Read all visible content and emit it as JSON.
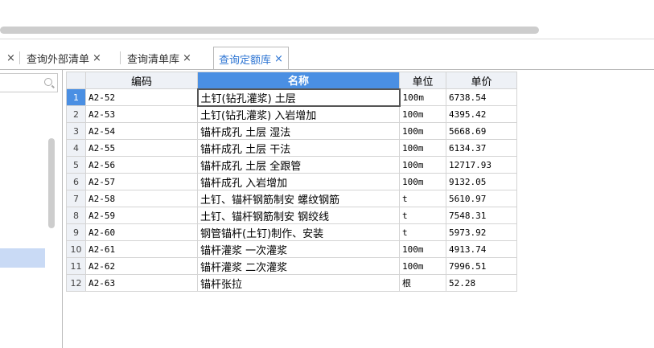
{
  "tabs": [
    {
      "label": "查询外部清单",
      "close": "×"
    },
    {
      "label": "查询清单库",
      "close": "×"
    },
    {
      "label": "查询定额库",
      "close": "×",
      "active": true
    }
  ],
  "leading_tab_close": "×",
  "colors": {
    "accent": "#4a8fe3",
    "active_tab_text": "#2c74d3",
    "selected_row": "#c9daf5"
  },
  "table": {
    "columns": [
      "编码",
      "名称",
      "单位",
      "单价"
    ],
    "rows": [
      {
        "no": "1",
        "code": "A2-52",
        "name": "土钉(钻孔灌浆) 土层",
        "unit": "100m",
        "price": "6738.54"
      },
      {
        "no": "2",
        "code": "A2-53",
        "name": "土钉(钻孔灌浆) 入岩增加",
        "unit": "100m",
        "price": "4395.42"
      },
      {
        "no": "3",
        "code": "A2-54",
        "name": "锚杆成孔 土层 湿法",
        "unit": "100m",
        "price": "5668.69"
      },
      {
        "no": "4",
        "code": "A2-55",
        "name": "锚杆成孔 土层 干法",
        "unit": "100m",
        "price": "6134.37"
      },
      {
        "no": "5",
        "code": "A2-56",
        "name": "锚杆成孔 土层 全跟管",
        "unit": "100m",
        "price": "12717.93"
      },
      {
        "no": "6",
        "code": "A2-57",
        "name": "锚杆成孔 入岩增加",
        "unit": "100m",
        "price": "9132.05"
      },
      {
        "no": "7",
        "code": "A2-58",
        "name": "土钉、锚杆钢筋制安 螺纹钢筋",
        "unit": "t",
        "price": "5610.97"
      },
      {
        "no": "8",
        "code": "A2-59",
        "name": "土钉、锚杆钢筋制安 钢绞线",
        "unit": "t",
        "price": "7548.31"
      },
      {
        "no": "9",
        "code": "A2-60",
        "name": "钢管锚杆(土钉)制作、安装",
        "unit": "t",
        "price": "5973.92"
      },
      {
        "no": "10",
        "code": "A2-61",
        "name": "锚杆灌浆 一次灌浆",
        "unit": "100m",
        "price": "4913.74"
      },
      {
        "no": "11",
        "code": "A2-62",
        "name": "锚杆灌浆 二次灌浆",
        "unit": "100m",
        "price": "7996.51"
      },
      {
        "no": "12",
        "code": "A2-63",
        "name": "锚杆张拉",
        "unit": "根",
        "price": "52.28"
      }
    ]
  }
}
